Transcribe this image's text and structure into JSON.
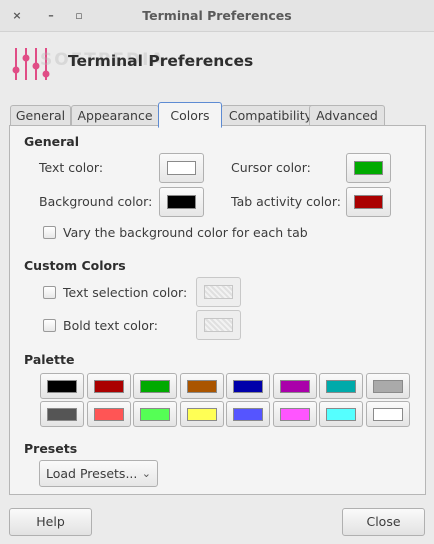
{
  "window": {
    "title": "Terminal Preferences",
    "close_glyph": "×",
    "minimize_glyph": "–",
    "maximize_glyph": "▫"
  },
  "header": {
    "title": "Terminal Preferences",
    "watermark": "SOFTPEDIA",
    "icon": "terminal-preferences-sliders-icon"
  },
  "tabs": [
    {
      "label": "General",
      "active": false
    },
    {
      "label": "Appearance",
      "active": false
    },
    {
      "label": "Colors",
      "active": true
    },
    {
      "label": "Compatibility",
      "active": false
    },
    {
      "label": "Advanced",
      "active": false
    }
  ],
  "general": {
    "heading": "General",
    "text_color_label": "Text color:",
    "cursor_color_label": "Cursor color:",
    "background_color_label": "Background color:",
    "tab_activity_color_label": "Tab activity color:",
    "vary_background_label": "Vary the background color for each tab",
    "vary_background_checked": false,
    "colors": {
      "text": "#ffffff",
      "cursor": "#00aa00",
      "background": "#000000",
      "tab_activity": "#aa0000"
    }
  },
  "custom_colors": {
    "heading": "Custom Colors",
    "text_selection_label": "Text selection color:",
    "bold_text_label": "Bold text color:",
    "text_selection_checked": false,
    "bold_text_checked": false
  },
  "palette": {
    "heading": "Palette",
    "colors": [
      "#000000",
      "#aa0000",
      "#00aa00",
      "#aa5500",
      "#0000aa",
      "#aa00aa",
      "#00aaaa",
      "#aaaaaa",
      "#555555",
      "#ff5555",
      "#55ff55",
      "#ffff55",
      "#5555ff",
      "#ff55ff",
      "#55ffff",
      "#ffffff"
    ]
  },
  "presets": {
    "heading": "Presets",
    "combo_label": "Load Presets...",
    "arrow_glyph": "⌄"
  },
  "buttons": {
    "help": "Help",
    "close": "Close"
  }
}
